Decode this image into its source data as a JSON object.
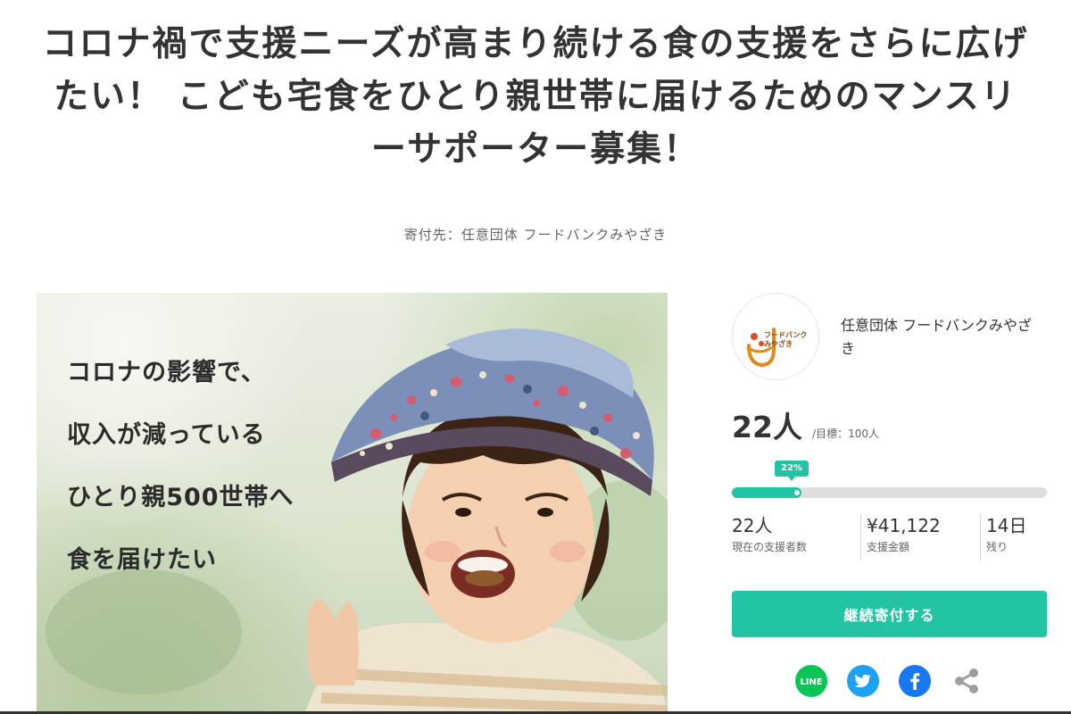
{
  "project": {
    "title": "コロナ禍で支援ニーズが高まり続ける食の支援をさらに広げたい！ こども宅食をひとり親世帯に届けるためのマンスリーサポーター募集！",
    "recipient": "寄付先：任意団体 フードバンクみやざき"
  },
  "hero": {
    "lines": [
      "コロナの影響で、",
      "収入が減っている",
      "ひとり親500世帯へ",
      "食を届けたい"
    ]
  },
  "organization": {
    "name": "任意団体 フードバンクみやざき",
    "logo_text": [
      "フードバンク",
      "みやざき"
    ]
  },
  "stats": {
    "supporters_big": "22人",
    "goal": "/目標：100人",
    "percent_label": "22%",
    "progress": 0.22,
    "supporters": "22人",
    "supporters_label": "現在の支援者数",
    "amount": "¥41,122",
    "amount_label": "支援金額",
    "days": "14日",
    "days_label": "残り"
  },
  "cta": {
    "label": "継続寄付する"
  },
  "share": {
    "line_label": "LINE",
    "icons": [
      "line-icon",
      "twitter-icon",
      "facebook-icon",
      "share-icon"
    ]
  },
  "colors": {
    "accent": "#22c4a4",
    "line": "#06c755",
    "twitter": "#1da1f2",
    "facebook": "#1877f2",
    "share": "#9e9e9e",
    "text": "#333333"
  }
}
